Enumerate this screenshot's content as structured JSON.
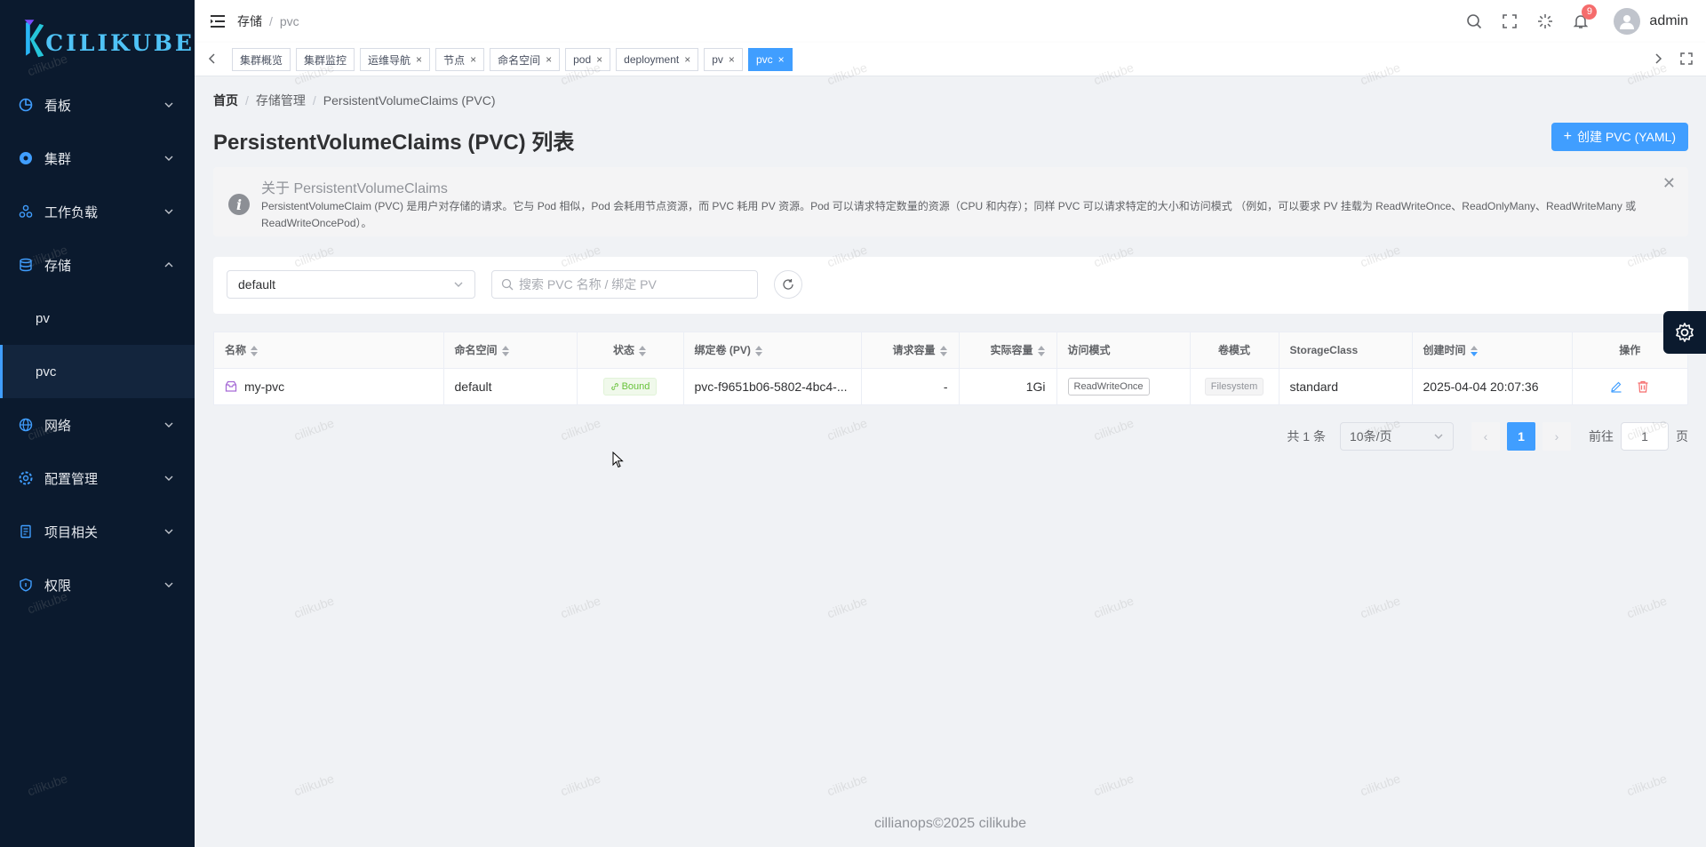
{
  "app": {
    "logo_text": "CILIKUBE",
    "brand_color": "#409eff",
    "sidebar_bg": "#0b1a2e"
  },
  "sidebar": {
    "items": [
      {
        "label": "看板",
        "icon": "dashboard-icon"
      },
      {
        "label": "集群",
        "icon": "cluster-icon"
      },
      {
        "label": "工作负载",
        "icon": "workload-icon"
      },
      {
        "label": "存储",
        "icon": "storage-icon",
        "expanded": true,
        "children": [
          {
            "label": "pv"
          },
          {
            "label": "pvc",
            "active": true
          }
        ]
      },
      {
        "label": "网络",
        "icon": "network-icon"
      },
      {
        "label": "配置管理",
        "icon": "config-icon"
      },
      {
        "label": "项目相关",
        "icon": "project-icon"
      },
      {
        "label": "权限",
        "icon": "permission-icon"
      }
    ]
  },
  "header": {
    "breadcrumb": [
      "存储",
      "pvc"
    ],
    "notification_count": "9",
    "username": "admin"
  },
  "tags": [
    {
      "label": "集群概览",
      "closable": false
    },
    {
      "label": "集群监控",
      "closable": false
    },
    {
      "label": "运维导航",
      "closable": true
    },
    {
      "label": "节点",
      "closable": true
    },
    {
      "label": "命名空间",
      "closable": true
    },
    {
      "label": "pod",
      "closable": true
    },
    {
      "label": "deployment",
      "closable": true
    },
    {
      "label": "pv",
      "closable": true
    },
    {
      "label": "pvc",
      "closable": true,
      "active": true
    }
  ],
  "main": {
    "breadcrumb": [
      "首页",
      "存储管理",
      "PersistentVolumeClaims (PVC)"
    ],
    "title": "PersistentVolumeClaims (PVC) 列表",
    "create_button": "创建 PVC (YAML)",
    "alert": {
      "title": "关于 PersistentVolumeClaims",
      "description": "PersistentVolumeClaim (PVC) 是用户对存储的请求。它与 Pod 相似，Pod 会耗用节点资源，而 PVC 耗用 PV 资源。Pod 可以请求特定数量的资源（CPU 和内存）；同样 PVC 可以请求特定的大小和访问模式 （例如，可以要求 PV 挂载为 ReadWriteOnce、ReadOnlyMany、ReadWriteMany 或 ReadWriteOncePod）。"
    },
    "filter": {
      "namespace": "default",
      "search_placeholder": "搜索 PVC 名称 / 绑定 PV"
    },
    "table": {
      "columns": [
        "名称",
        "命名空间",
        "状态",
        "绑定卷 (PV)",
        "请求容量",
        "实际容量",
        "访问模式",
        "卷模式",
        "StorageClass",
        "创建时间",
        "操作"
      ],
      "rows": [
        {
          "name": "my-pvc",
          "namespace": "default",
          "status": "Bound",
          "volume": "pvc-f9651b06-5802-4bc4-...",
          "request": "-",
          "capacity": "1Gi",
          "access_mode": "ReadWriteOnce",
          "volume_mode": "Filesystem",
          "storage_class": "standard",
          "created": "2025-04-04 20:07:36"
        }
      ]
    },
    "pagination": {
      "total": "共 1 条",
      "page_size": "10条/页",
      "current_page": "1",
      "goto_prefix": "前往",
      "goto_value": "1",
      "goto_suffix": "页"
    }
  },
  "footer": {
    "text": "cillianops©2025 cilikube"
  },
  "watermark": "cilikube"
}
